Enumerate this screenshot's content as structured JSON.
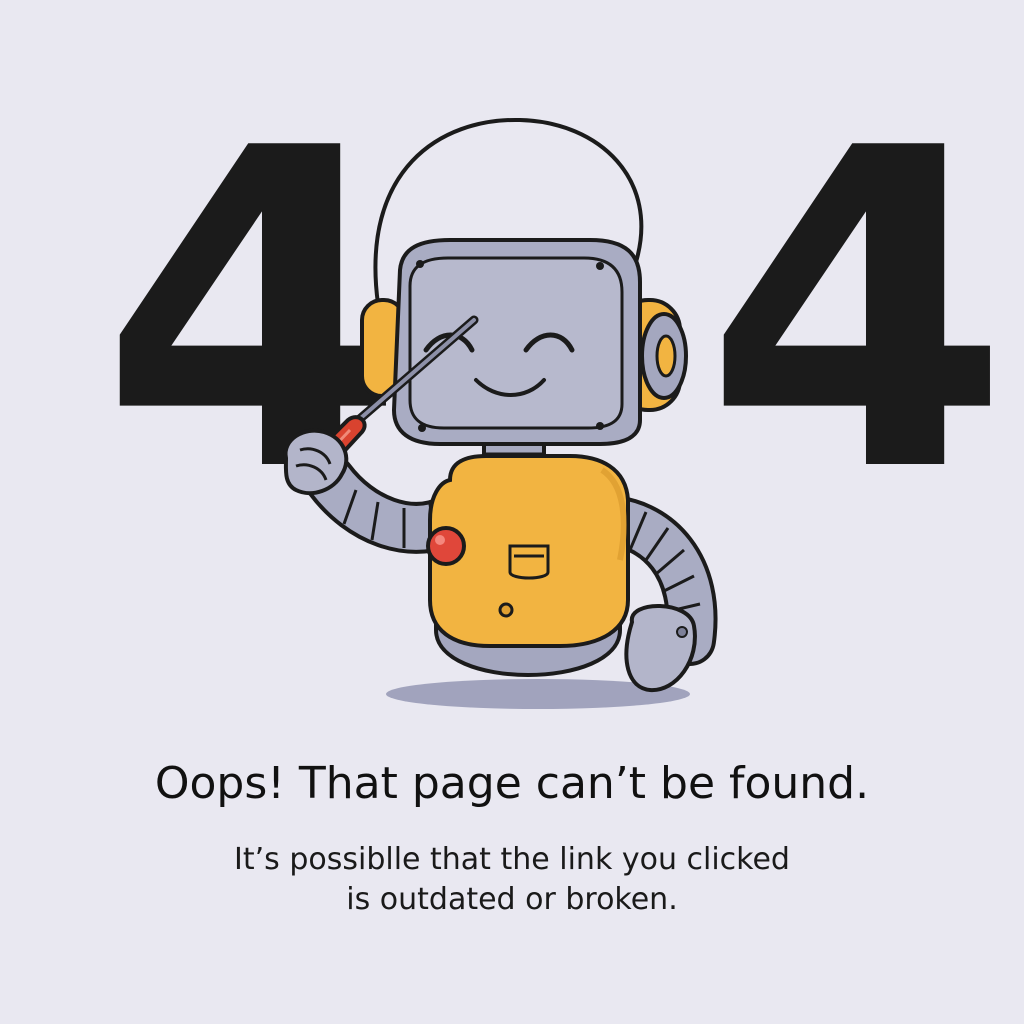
{
  "error": {
    "digit_first": "4",
    "digit_last": "4"
  },
  "message": {
    "headline": "Oops! That page can’t be found.",
    "subtext_line1": "It’s possiblle that the link you clicked",
    "subtext_line2": "is outdated or broken."
  },
  "illustration": {
    "name": "robot-with-screwdriver",
    "colors": {
      "background": "#e9e8f1",
      "text": "#1b1b1b",
      "robot_body": "#f2b441",
      "robot_metal": "#a7aac0",
      "robot_button": "#e0473a",
      "screwdriver_handle": "#d9432f"
    }
  }
}
